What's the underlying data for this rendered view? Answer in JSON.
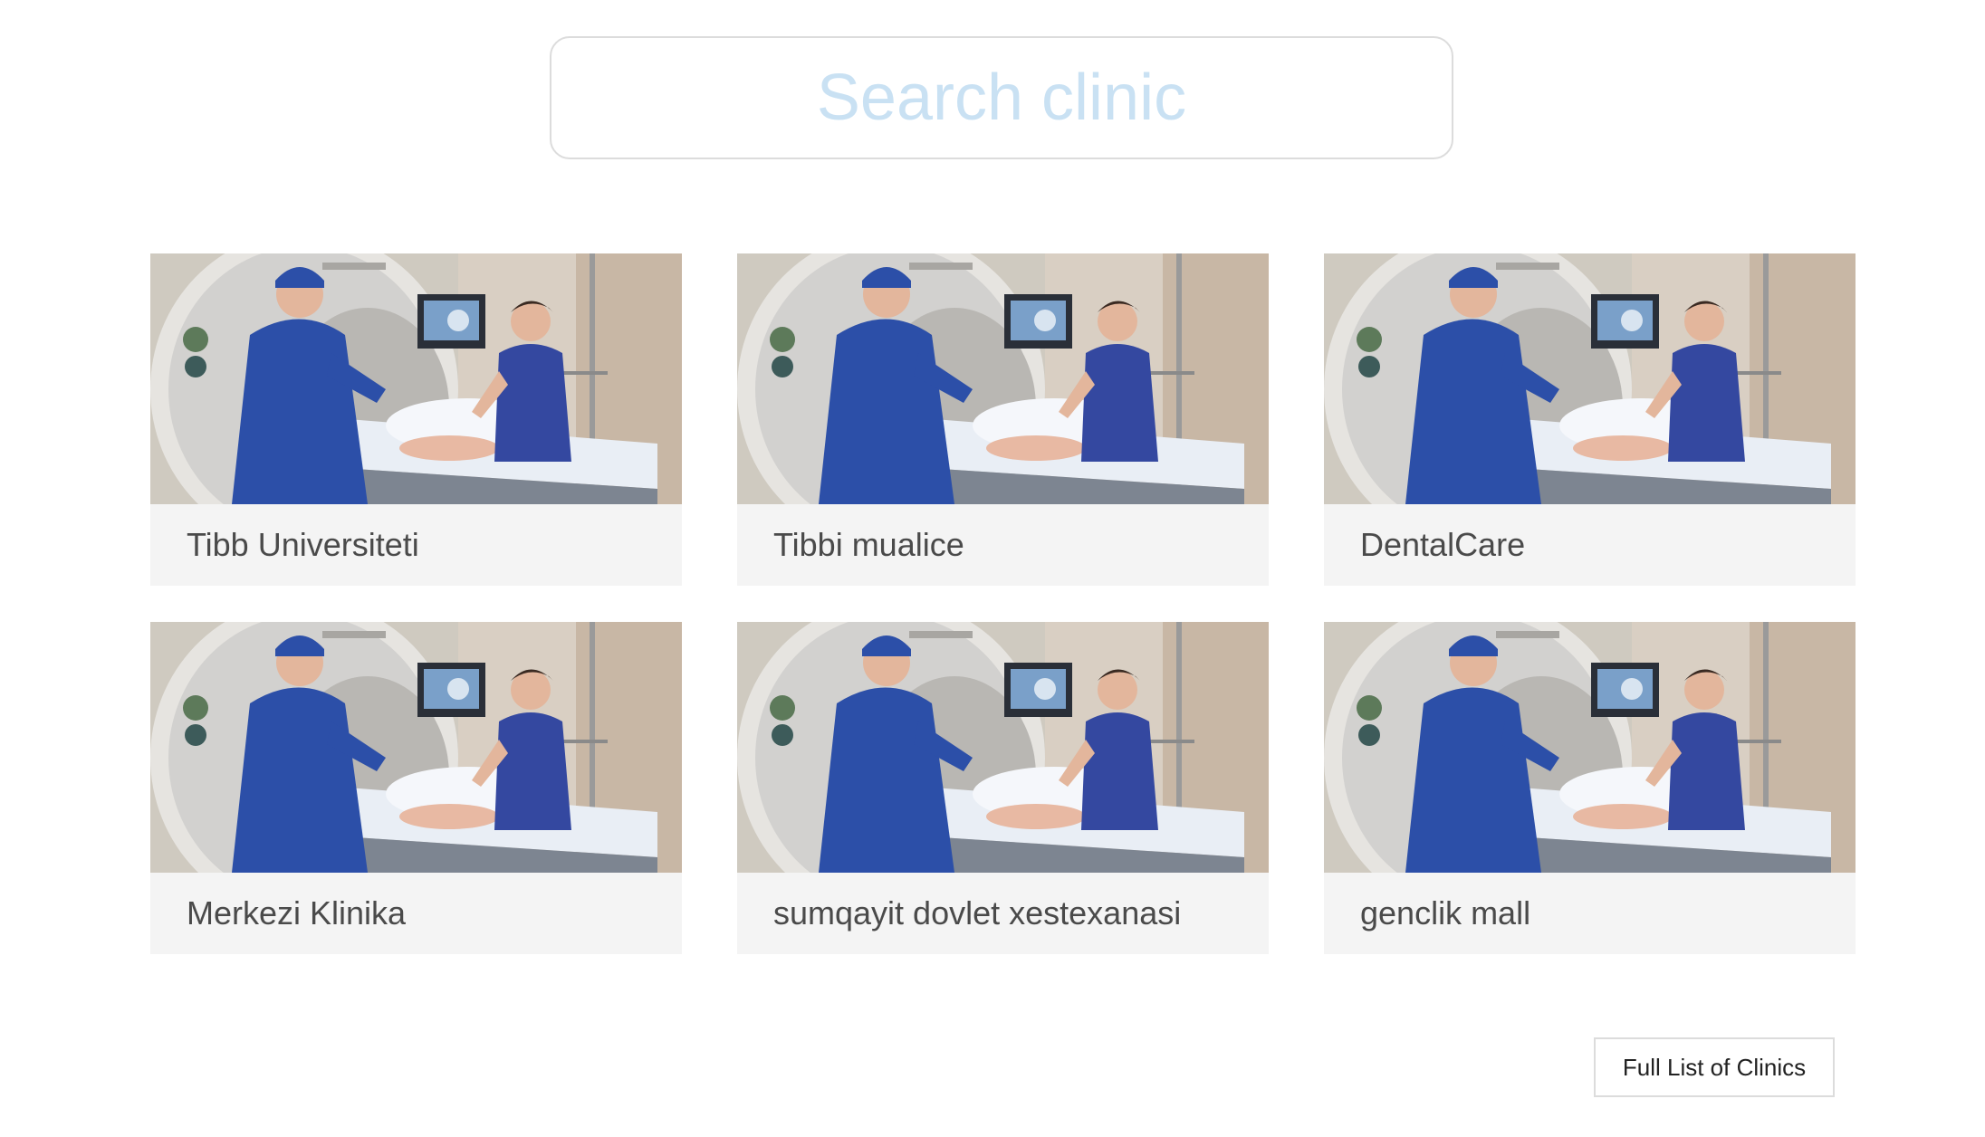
{
  "search": {
    "placeholder": "Search clinic",
    "value": ""
  },
  "clinics": [
    {
      "name": "Tibb Universiteti",
      "image": "medical-scan-photo"
    },
    {
      "name": "Tibbi mualice",
      "image": "medical-scan-photo"
    },
    {
      "name": "DentalCare",
      "image": "medical-scan-photo"
    },
    {
      "name": "Merkezi Klinika",
      "image": "medical-scan-photo"
    },
    {
      "name": "sumqayit dovlet xestexanasi",
      "image": "medical-scan-photo"
    },
    {
      "name": "genclik mall",
      "image": "medical-scan-photo"
    }
  ],
  "footer": {
    "full_list_label": "Full List of Clinics"
  },
  "colors": {
    "placeholder": "#c9e1f3",
    "card_background": "#f4f4f4",
    "scrubs": "#2c4fa8"
  }
}
